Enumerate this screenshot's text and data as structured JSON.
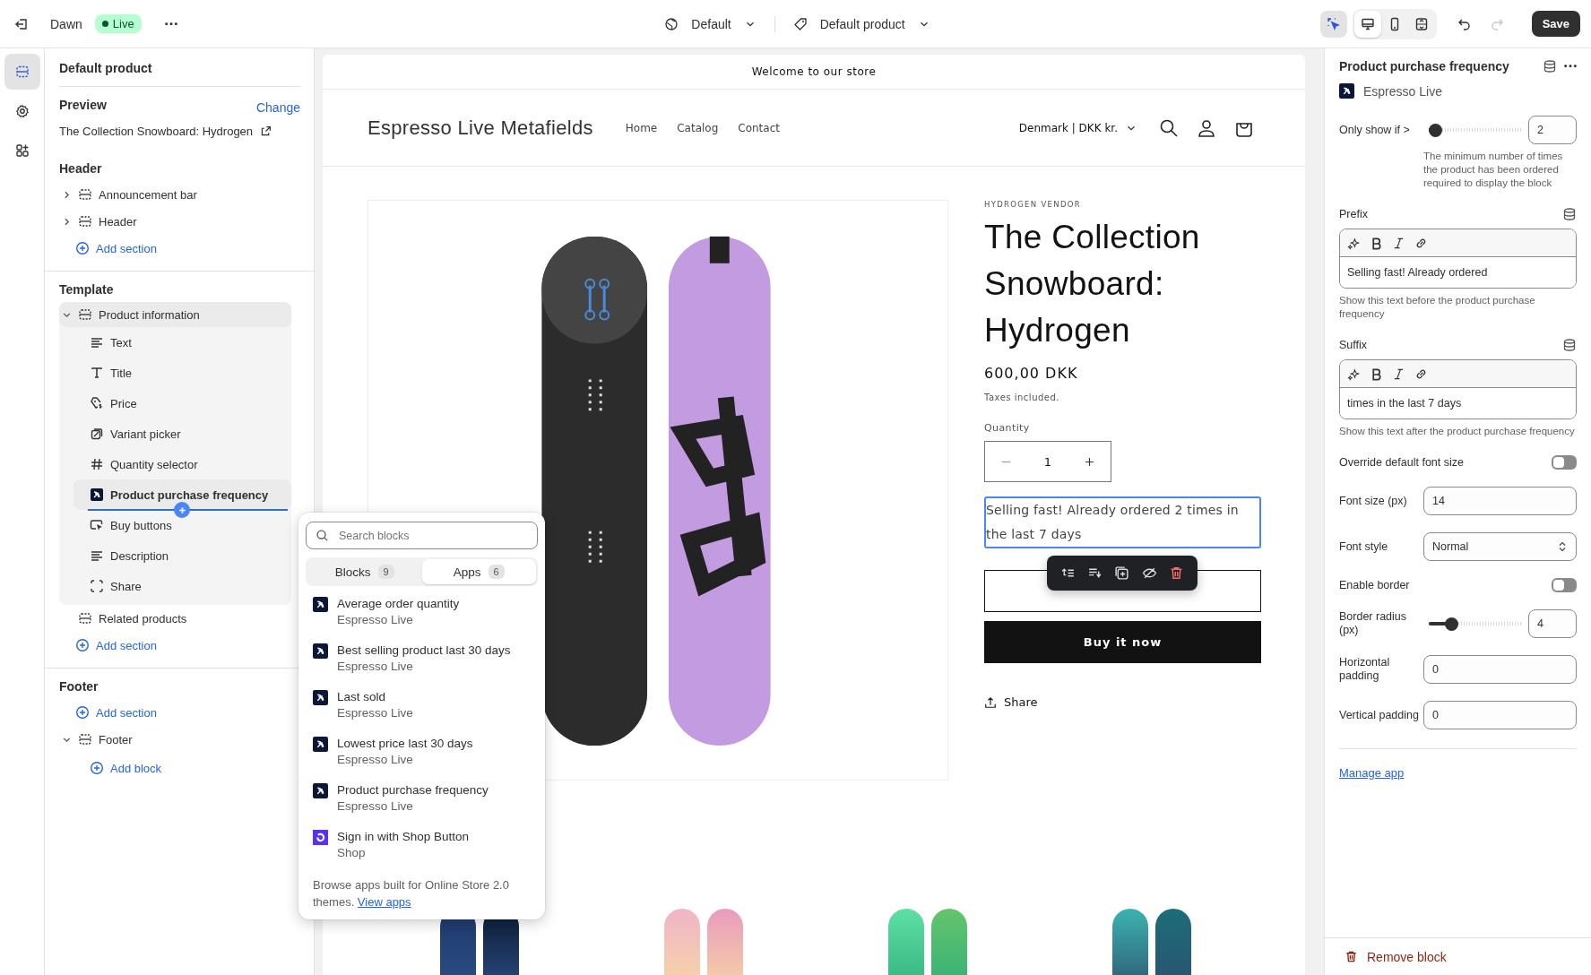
{
  "top_bar": {
    "theme": "Dawn",
    "status": "Live",
    "template_selector": "Default",
    "page_selector": "Default product",
    "save": "Save",
    "inspector": {
      "selected": true
    },
    "view_modes": [
      {
        "kind": "desktop",
        "selected": true
      },
      {
        "kind": "mobile",
        "selected": false
      },
      {
        "kind": "fullwidth",
        "selected": false
      }
    ],
    "undo": {
      "disabled": false
    },
    "redo": {
      "disabled": true
    }
  },
  "rail": [
    {
      "kind": "sections",
      "selected": true
    },
    {
      "kind": "settings",
      "selected": false
    },
    {
      "kind": "apps",
      "selected": false
    }
  ],
  "sidebar": {
    "title": "Default product",
    "preview": {
      "label": "Preview",
      "action": "Change",
      "value": "The Collection Snowboard: Hydrogen"
    },
    "groups": [
      {
        "title": "Header",
        "items": [
          {
            "kind": "section",
            "label": "Announcement bar",
            "expanded": false
          },
          {
            "kind": "section",
            "label": "Header",
            "expanded": false
          },
          {
            "kind": "add",
            "label": "Add section"
          }
        ]
      },
      {
        "title": "Template",
        "items": [
          {
            "kind": "section",
            "label": "Product information",
            "expanded": true,
            "children": [
              {
                "kind": "text",
                "label": "Text",
                "selected": false,
                "insert_after": false
              },
              {
                "kind": "title",
                "label": "Title",
                "selected": false,
                "insert_after": false
              },
              {
                "kind": "price",
                "label": "Price",
                "selected": false,
                "insert_after": false
              },
              {
                "kind": "variant",
                "label": "Variant picker",
                "selected": false,
                "insert_after": false
              },
              {
                "kind": "quantity",
                "label": "Quantity selector",
                "selected": false,
                "insert_after": false
              },
              {
                "kind": "app",
                "label": "Product purchase frequency",
                "selected": true,
                "insert_after": true
              },
              {
                "kind": "buy",
                "label": "Buy buttons",
                "selected": false,
                "insert_after": false
              },
              {
                "kind": "text",
                "label": "Description",
                "selected": false,
                "insert_after": false
              },
              {
                "kind": "share",
                "label": "Share",
                "selected": false,
                "insert_after": false
              }
            ]
          },
          {
            "kind": "section",
            "label": "Related products"
          },
          {
            "kind": "add",
            "label": "Add section"
          }
        ]
      },
      {
        "title": "Footer",
        "items": [
          {
            "kind": "add",
            "label": "Add section"
          },
          {
            "kind": "section",
            "label": "Footer",
            "expanded": true,
            "children": [
              {
                "kind": "add",
                "label": "Add block",
                "selected": false,
                "insert_after": false
              }
            ]
          }
        ]
      }
    ]
  },
  "block_picker": {
    "search_placeholder": "Search blocks",
    "tabs": [
      {
        "label": "Blocks",
        "count": "9",
        "selected": false
      },
      {
        "label": "Apps",
        "count": "6",
        "selected": true
      }
    ],
    "items": [
      {
        "kind": "espresso",
        "title": "Average order quantity",
        "app": "Espresso Live"
      },
      {
        "kind": "espresso",
        "title": "Best selling product last 30 days",
        "app": "Espresso Live"
      },
      {
        "kind": "espresso",
        "title": "Last sold",
        "app": "Espresso Live"
      },
      {
        "kind": "espresso",
        "title": "Lowest price last 30 days",
        "app": "Espresso Live"
      },
      {
        "kind": "espresso",
        "title": "Product purchase frequency",
        "app": "Espresso Live"
      },
      {
        "kind": "shop",
        "title": "Sign in with Shop Button",
        "app": "Shop"
      }
    ],
    "footer": "Browse apps built for Online Store 2.0 themes.",
    "footer_link": "View apps"
  },
  "store": {
    "announcement": "Welcome to our store",
    "logo": "Espresso Live Metafields",
    "nav": [
      "Home",
      "Catalog",
      "Contact"
    ],
    "locale": "Denmark | DKK kr.",
    "product": {
      "vendor": "HYDROGEN VENDOR",
      "title": "The Collection Snowboard: Hydrogen",
      "price": "600,00 DKK",
      "tax_note": "Taxes included.",
      "quantity_label": "Quantity",
      "quantity": "1",
      "purchase_frequency": "Selling fast! Already ordered 2 times in the last 7 days",
      "buy_now": "Buy it now",
      "share": "Share"
    }
  },
  "settings_panel": {
    "title": "Product purchase frequency",
    "app": "Espresso Live",
    "settings": [
      {
        "kind": "range",
        "label": "Only show if >",
        "level": 0,
        "value": "2",
        "help": "The minimum number of times the product has been ordered required to display the block"
      },
      {
        "kind": "richtext",
        "label": "Prefix",
        "value": "Selling fast! Already ordered",
        "help": "Show this text before the product purchase frequency"
      },
      {
        "kind": "richtext",
        "label": "Suffix",
        "value": "times in the last 7 days",
        "help": "Show this text after the product purchase frequency"
      },
      {
        "kind": "toggle",
        "label": "Override default font size",
        "on": false
      },
      {
        "kind": "number",
        "label": "Font size (px)",
        "value": "14"
      },
      {
        "kind": "select",
        "label": "Font style",
        "value": "Normal"
      },
      {
        "kind": "toggle",
        "label": "Enable border",
        "on": false
      },
      {
        "kind": "range",
        "label": "Border radius (px)",
        "level": 0.2,
        "value": "4"
      },
      {
        "kind": "number",
        "label": "Horizontal padding",
        "value": "0"
      },
      {
        "kind": "number",
        "label": "Vertical padding",
        "value": "0"
      }
    ],
    "manage_link": "Manage app",
    "remove": "Remove block"
  }
}
